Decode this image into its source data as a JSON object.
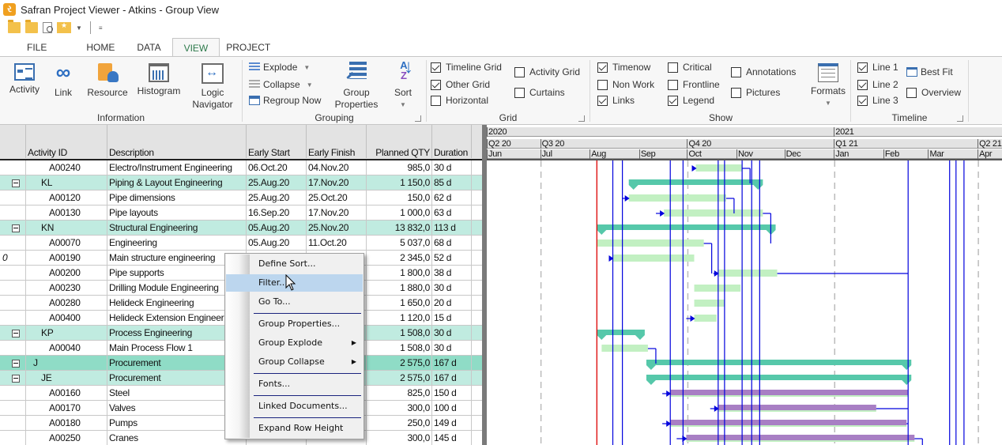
{
  "window": {
    "title": "Safran Project Viewer - Atkins - Group View",
    "app_icon": "safran-logo-icon"
  },
  "quick_access": [
    {
      "name": "open-folder-icon"
    },
    {
      "name": "reopen-folder-icon"
    },
    {
      "name": "print-preview-icon"
    },
    {
      "name": "favorites-icon"
    },
    {
      "name": "customize-toolbar-icon",
      "glyph": "≡"
    }
  ],
  "tabs": [
    {
      "label": "FILE",
      "active": false
    },
    {
      "label": "HOME",
      "active": false
    },
    {
      "label": "DATA",
      "active": false
    },
    {
      "label": "VIEW",
      "active": true
    },
    {
      "label": "PROJECT",
      "active": false
    }
  ],
  "ribbon": {
    "information": {
      "label": "Information",
      "buttons": [
        {
          "label": "Activity"
        },
        {
          "label": "Link"
        },
        {
          "label": "Resource"
        },
        {
          "label": "Histogram"
        },
        {
          "label": "Logic Navigator"
        }
      ]
    },
    "grouping": {
      "label": "Grouping",
      "explode": "Explode",
      "collapse": "Collapse",
      "regroup": "Regroup Now",
      "group_properties_1": "Group",
      "group_properties_2": "Properties",
      "sort": "Sort"
    },
    "grid": {
      "label": "Grid",
      "options": [
        {
          "label": "Timeline Grid",
          "checked": true
        },
        {
          "label": "Other Grid",
          "checked": true
        },
        {
          "label": "Horizontal",
          "checked": false
        },
        {
          "label": "Activity Grid",
          "checked": false
        },
        {
          "label": "Curtains",
          "checked": false
        }
      ]
    },
    "show": {
      "label": "Show",
      "options": [
        {
          "label": "Timenow",
          "checked": true
        },
        {
          "label": "Non Work",
          "checked": false
        },
        {
          "label": "Links",
          "checked": true
        },
        {
          "label": "Critical",
          "checked": false
        },
        {
          "label": "Frontline",
          "checked": false
        },
        {
          "label": "Legend",
          "checked": true
        },
        {
          "label": "Annotations",
          "checked": false
        },
        {
          "label": "Pictures",
          "checked": false
        }
      ],
      "formats": "Formats"
    },
    "timeline": {
      "label": "Timeline",
      "options": [
        {
          "label": "Line 1",
          "checked": true
        },
        {
          "label": "Line 2",
          "checked": true
        },
        {
          "label": "Line 3",
          "checked": true
        },
        {
          "label": "Overview",
          "checked": false
        }
      ],
      "best_fit": "Best Fit"
    }
  },
  "table": {
    "columns": [
      "Activity ID",
      "Description",
      "Early Start",
      "Early Finish",
      "Planned QTY",
      "Duration"
    ],
    "rows": [
      {
        "level": "activity",
        "id": "A00240",
        "desc": "Electro/Instrument Engineering",
        "start": "06.Oct.20",
        "finish": "04.Nov.20",
        "qty": "985,0",
        "dur": "30 d"
      },
      {
        "level": "group1",
        "id": "KL",
        "desc": "Piping & Layout Engineering",
        "start": "25.Aug.20",
        "finish": "17.Nov.20",
        "qty": "1 150,0",
        "dur": "85 d"
      },
      {
        "level": "activity",
        "id": "A00120",
        "desc": "Pipe dimensions",
        "start": "25.Aug.20",
        "finish": "25.Oct.20",
        "qty": "150,0",
        "dur": "62 d"
      },
      {
        "level": "activity",
        "id": "A00130",
        "desc": "Pipe layouts",
        "start": "16.Sep.20",
        "finish": "17.Nov.20",
        "qty": "1 000,0",
        "dur": "63 d"
      },
      {
        "level": "group1",
        "id": "KN",
        "desc": "Structural Engineering",
        "start": "05.Aug.20",
        "finish": "25.Nov.20",
        "qty": "13 832,0",
        "dur": "113 d"
      },
      {
        "level": "activity",
        "id": "A00070",
        "desc": "Engineering",
        "start": "05.Aug.20",
        "finish": "11.Oct.20",
        "qty": "5 037,0",
        "dur": "68 d"
      },
      {
        "level": "activity",
        "id": "A00190",
        "desc": "Main structure engineering",
        "start": "",
        "finish": "",
        "qty": "2 345,0",
        "dur": "52 d",
        "attachment": true
      },
      {
        "level": "activity",
        "id": "A00200",
        "desc": "Pipe supports",
        "start": "",
        "finish": "",
        "qty": "1 800,0",
        "dur": "38 d"
      },
      {
        "level": "activity",
        "id": "A00230",
        "desc": "Drilling Module Engineering",
        "start": "",
        "finish": "",
        "qty": "1 880,0",
        "dur": "30 d"
      },
      {
        "level": "activity",
        "id": "A00280",
        "desc": "Helideck Engineering",
        "start": "",
        "finish": "",
        "qty": "1 650,0",
        "dur": "20 d"
      },
      {
        "level": "activity",
        "id": "A00400",
        "desc": "Helideck Extension Engineering",
        "start": "",
        "finish": "",
        "qty": "1 120,0",
        "dur": "15 d"
      },
      {
        "level": "group1",
        "id": "KP",
        "desc": "Process Engineering",
        "start": "",
        "finish": "",
        "qty": "1 508,0",
        "dur": "30 d"
      },
      {
        "level": "activity",
        "id": "A00040",
        "desc": "Main Process Flow 1",
        "start": "",
        "finish": "",
        "qty": "1 508,0",
        "dur": "30 d"
      },
      {
        "level": "group0",
        "id": "J",
        "desc": "Procurement",
        "start": "",
        "finish": "",
        "qty": "2 575,0",
        "dur": "167 d"
      },
      {
        "level": "group1",
        "id": "JE",
        "desc": "Procurement",
        "start": "",
        "finish": "",
        "qty": "2 575,0",
        "dur": "167 d"
      },
      {
        "level": "activity",
        "id": "A00160",
        "desc": "Steel",
        "start": "",
        "finish": "",
        "qty": "825,0",
        "dur": "150 d"
      },
      {
        "level": "activity",
        "id": "A00170",
        "desc": "Valves",
        "start": "",
        "finish": "",
        "qty": "300,0",
        "dur": "100 d"
      },
      {
        "level": "activity",
        "id": "A00180",
        "desc": "Pumps",
        "start": "",
        "finish": "",
        "qty": "250,0",
        "dur": "149 d"
      },
      {
        "level": "activity",
        "id": "A00250",
        "desc": "Cranes",
        "start": "",
        "finish": "",
        "qty": "300,0",
        "dur": "145 d"
      }
    ]
  },
  "gantt": {
    "timeline": {
      "years": [
        "2020",
        "2021"
      ],
      "quarters": [
        "Q2 20",
        "Q3 20",
        "Q4 20",
        "Q1 21",
        "Q2 21"
      ],
      "months": [
        "Jun",
        "Jul",
        "Aug",
        "Sep",
        "Oct",
        "Nov",
        "Dec",
        "Jan",
        "Feb",
        "Mar",
        "Apr"
      ]
    },
    "colors": {
      "summary": "#56c8aa",
      "activity": "#c2f0c2",
      "procurement": "#a87fc4",
      "link": "#0000dd",
      "timenow": "#dd0000",
      "grid": "#bbbbbb"
    },
    "bars": [
      {
        "row": 0,
        "type": "activity",
        "start": "2020-10-06",
        "finish": "2020-11-04"
      },
      {
        "row": 1,
        "type": "summary",
        "start": "2020-08-25",
        "finish": "2020-11-17"
      },
      {
        "row": 2,
        "type": "activity",
        "start": "2020-08-25",
        "finish": "2020-10-25"
      },
      {
        "row": 3,
        "type": "activity",
        "start": "2020-09-16",
        "finish": "2020-11-17"
      },
      {
        "row": 4,
        "type": "summary",
        "start": "2020-08-05",
        "finish": "2020-11-25"
      },
      {
        "row": 5,
        "type": "activity",
        "start": "2020-08-05",
        "finish": "2020-10-11"
      },
      {
        "row": 6,
        "type": "activity",
        "start": "2020-08-15",
        "finish": "2020-10-05"
      },
      {
        "row": 7,
        "type": "activity",
        "start": "2020-10-20",
        "finish": "2020-11-26"
      },
      {
        "row": 8,
        "type": "activity",
        "start": "2020-10-05",
        "finish": "2020-11-03"
      },
      {
        "row": 9,
        "type": "activity",
        "start": "2020-10-05",
        "finish": "2020-10-24"
      },
      {
        "row": 10,
        "type": "activity",
        "start": "2020-10-05",
        "finish": "2020-10-19"
      },
      {
        "row": 11,
        "type": "summary",
        "start": "2020-08-05",
        "finish": "2020-09-04"
      },
      {
        "row": 12,
        "type": "activity",
        "start": "2020-08-08",
        "finish": "2020-09-06"
      },
      {
        "row": 13,
        "type": "summary",
        "start": "2020-09-05",
        "finish": "2021-02-18"
      },
      {
        "row": 14,
        "type": "summary",
        "start": "2020-09-05",
        "finish": "2021-02-18"
      },
      {
        "row": 15,
        "type": "procurement",
        "start": "2020-09-20",
        "finish": "2021-02-16"
      },
      {
        "row": 16,
        "type": "procurement",
        "start": "2020-10-20",
        "finish": "2021-01-27"
      },
      {
        "row": 17,
        "type": "procurement",
        "start": "2020-09-20",
        "finish": "2021-02-15"
      },
      {
        "row": 18,
        "type": "procurement",
        "start": "2020-09-30",
        "finish": "2021-02-20"
      }
    ],
    "timenow": "2020-08-05"
  },
  "context_menu": {
    "items": [
      {
        "label": "Define Sort...",
        "highlighted": false
      },
      {
        "label": "Filter...",
        "highlighted": true
      },
      {
        "label": "Go To...",
        "highlighted": false,
        "sep_after": true
      },
      {
        "label": "Group Properties...",
        "highlighted": false
      },
      {
        "label": "Group Explode",
        "highlighted": false,
        "submenu": true
      },
      {
        "label": "Group Collapse",
        "highlighted": false,
        "submenu": true,
        "sep_after": true
      },
      {
        "label": "Fonts...",
        "highlighted": false,
        "sep_after": true
      },
      {
        "label": "Linked Documents...",
        "highlighted": false,
        "sep_after": true
      },
      {
        "label": "Expand Row Height",
        "highlighted": false
      }
    ]
  }
}
